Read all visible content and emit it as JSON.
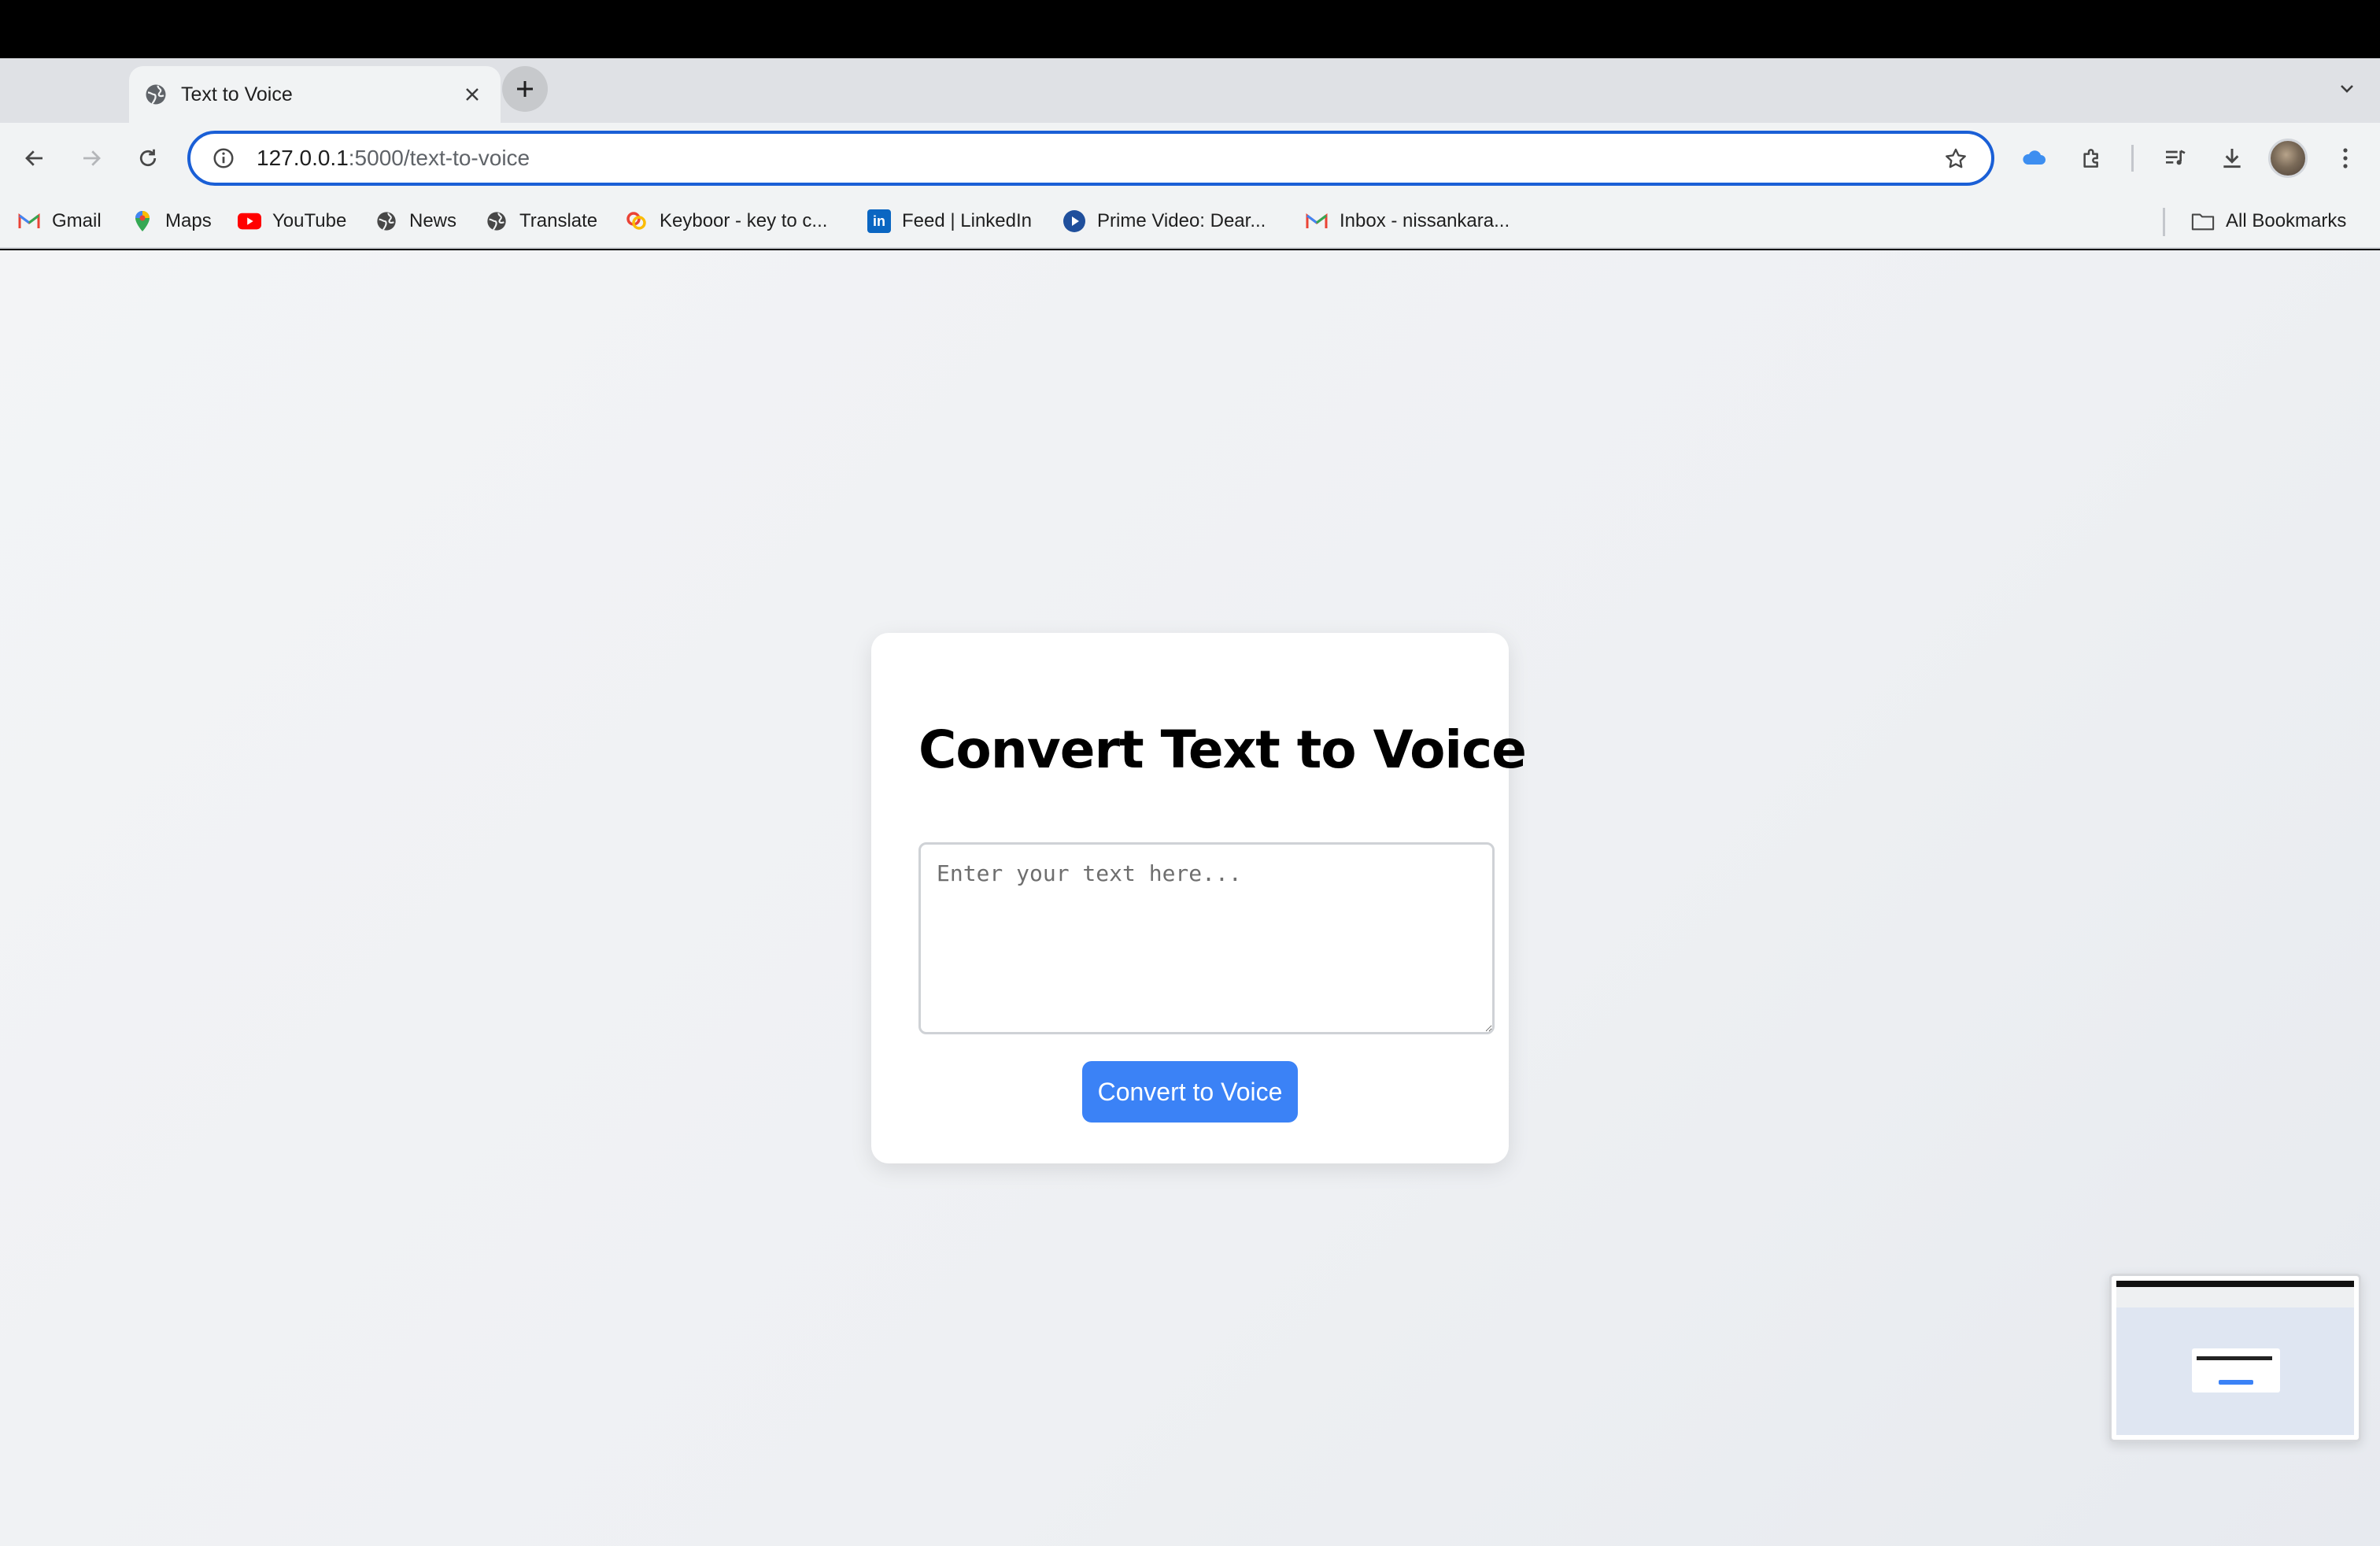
{
  "browser": {
    "tab": {
      "title": "Text to Voice",
      "favicon": "globe-icon"
    },
    "address": {
      "host": "127.0.0.1",
      "path": ":5000/text-to-voice"
    },
    "bookmarks": [
      {
        "label": "Gmail",
        "icon": "gmail-icon"
      },
      {
        "label": "Maps",
        "icon": "maps-icon"
      },
      {
        "label": "YouTube",
        "icon": "youtube-icon"
      },
      {
        "label": "News",
        "icon": "globe-icon"
      },
      {
        "label": "Translate",
        "icon": "globe-icon"
      },
      {
        "label": "Keyboor - key to c...",
        "icon": "keyboor-icon"
      },
      {
        "label": "Feed | LinkedIn",
        "icon": "linkedin-icon"
      },
      {
        "label": "Prime Video: Dear...",
        "icon": "prime-video-icon"
      },
      {
        "label": "Inbox - nissankara...",
        "icon": "gmail-icon"
      }
    ],
    "all_bookmarks_label": "All Bookmarks"
  },
  "page": {
    "heading": "Convert Text to Voice",
    "textarea_placeholder": "Enter your text here...",
    "button_label": "Convert to Voice",
    "accent_color": "#3b82f6"
  }
}
